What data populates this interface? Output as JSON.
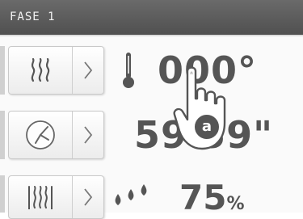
{
  "header": {
    "title": "FASE 1"
  },
  "rows": [
    {
      "icon": "heat-waves-icon",
      "chevron": "chevron-right-icon"
    },
    {
      "icon": "clock-icon",
      "chevron": "chevron-right-icon"
    },
    {
      "icon": "steam-icon",
      "chevron": "chevron-right-icon"
    }
  ],
  "readouts": {
    "temperature": "000°",
    "time": "59'59\"",
    "humidity_value": "75",
    "humidity_unit": "%"
  },
  "indicator_icons": [
    "thermometer-icon",
    "droplets-icon"
  ],
  "overlay": {
    "hand_icon": "tap-hand-icon",
    "badge": "a"
  }
}
